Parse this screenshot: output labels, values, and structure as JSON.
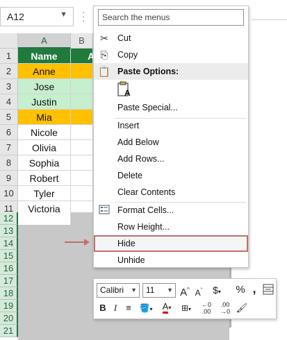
{
  "name_box": {
    "value": "A12"
  },
  "columns": {
    "a": "A",
    "b": "B"
  },
  "rows": [
    {
      "num": "1",
      "name": "Name",
      "b": "A",
      "style": "header"
    },
    {
      "num": "2",
      "name": "Anne",
      "b": "",
      "style": "orange"
    },
    {
      "num": "3",
      "name": "Jose",
      "b": "",
      "style": "green"
    },
    {
      "num": "4",
      "name": "Justin",
      "b": "",
      "style": "green"
    },
    {
      "num": "5",
      "name": "Mia",
      "b": "",
      "style": "orange"
    },
    {
      "num": "6",
      "name": "Nicole",
      "b": "",
      "style": "plain"
    },
    {
      "num": "7",
      "name": "Olivia",
      "b": "",
      "style": "plain"
    },
    {
      "num": "8",
      "name": "Sophia",
      "b": "",
      "style": "plain"
    },
    {
      "num": "9",
      "name": "Robert",
      "b": "",
      "style": "plain"
    },
    {
      "num": "10",
      "name": "Tyler",
      "b": "",
      "style": "plain"
    },
    {
      "num": "11",
      "name": "Victoria",
      "b": "",
      "style": "plain"
    }
  ],
  "selected_rows": [
    "12",
    "13",
    "14",
    "15",
    "16",
    "17",
    "18",
    "19",
    "20",
    "21"
  ],
  "context_menu": {
    "search_placeholder": "Search the menus",
    "items": {
      "cut": "Cut",
      "copy": "Copy",
      "paste_options": "Paste Options:",
      "paste_special": "Paste Special...",
      "insert": "Insert",
      "add_below": "Add Below",
      "add_rows": "Add Rows...",
      "delete": "Delete",
      "clear_contents": "Clear Contents",
      "format_cells": "Format Cells...",
      "row_height": "Row Height...",
      "hide": "Hide",
      "unhide": "Unhide"
    }
  },
  "mini_toolbar": {
    "font": "Calibri",
    "size": "11"
  },
  "colors": {
    "header_fill": "#1f7a3c",
    "orange_fill": "#ffc000",
    "green_fill": "#c6efce",
    "highlight_border": "#c0706a",
    "excel_green": "#217346"
  }
}
